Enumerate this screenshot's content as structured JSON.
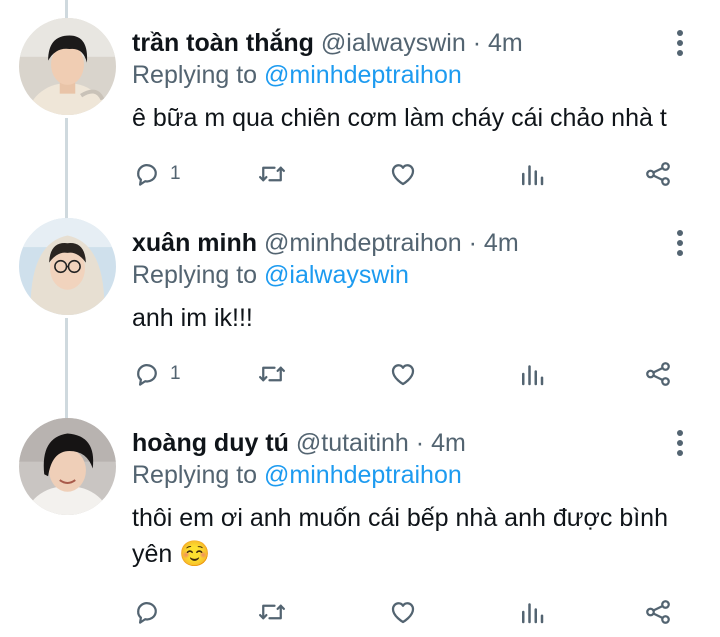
{
  "icons": {
    "reply": "reply-bubble-icon",
    "retweet": "retweet-icon",
    "like": "heart-icon",
    "views": "analytics-bars-icon",
    "share": "share-nodes-icon",
    "more": "more-vertical-icon"
  },
  "colors": {
    "text": "#0f1419",
    "muted": "#536471",
    "link": "#1d9bf0",
    "thread_line": "#cfd9de"
  },
  "tweets": [
    {
      "name": "trần toàn thắng",
      "handle": "@ialwayswin",
      "separator": "·",
      "time": "4m",
      "replying_prefix": "Replying to",
      "replying_to": "@minhdeptraihon",
      "text": "ê bữa m qua chiên cơm làm cháy cái chảo nhà t",
      "reply_count": "1"
    },
    {
      "name": "xuân minh",
      "handle": "@minhdeptraihon",
      "separator": "·",
      "time": "4m",
      "replying_prefix": "Replying to",
      "replying_to": "@ialwayswin",
      "text": "anh im ik!!!",
      "reply_count": "1"
    },
    {
      "name": "hoàng duy tú",
      "handle": "@tutaitinh",
      "separator": "·",
      "time": "4m",
      "replying_prefix": "Replying to",
      "replying_to": "@minhdeptraihon",
      "text": "thôi em ơi anh muốn cái bếp nhà anh được bình yên ☺️",
      "reply_count": ""
    }
  ]
}
